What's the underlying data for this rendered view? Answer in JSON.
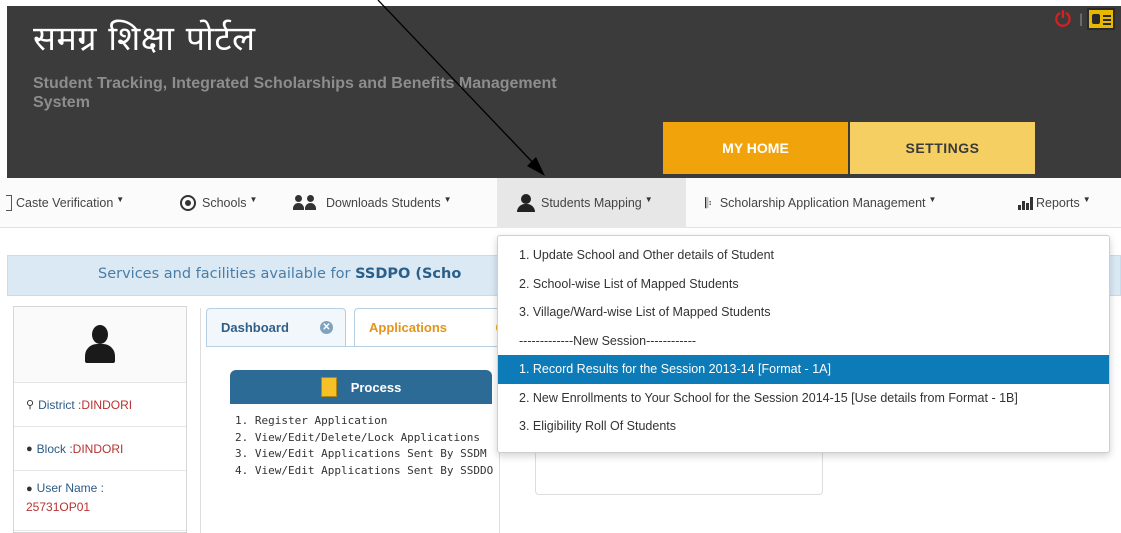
{
  "header": {
    "title": "समग्र शिक्षा पोर्टल",
    "subtitle": "Student Tracking, Integrated Scholarships and Benefits Management System",
    "tabs": [
      {
        "label": "MY HOME",
        "color": "#f0a30a"
      },
      {
        "label": "SETTINGS",
        "color": "#f6cf63"
      }
    ],
    "top_icons": [
      "power-icon",
      "id-card-icon"
    ],
    "top_separator": "|"
  },
  "menu": {
    "items": [
      {
        "label": "Caste Verification",
        "icon": "bracket-icon"
      },
      {
        "label": "Schools",
        "icon": "circle-icon"
      },
      {
        "label": "Downloads Students",
        "icon": "users-icon"
      },
      {
        "label": "Students Mapping",
        "icon": "user-icon",
        "active": true
      },
      {
        "label": "Scholarship Application Management",
        "icon": "paperclip-icon"
      },
      {
        "label": "Reports",
        "icon": "bar-chart-icon"
      }
    ],
    "caret": "▼"
  },
  "dropdown": {
    "items": [
      {
        "label": "1. Update School and Other details of Student"
      },
      {
        "label": "2. School-wise List of Mapped Students"
      },
      {
        "label": "3. Village/Ward-wise List of Mapped Students"
      },
      {
        "label": "-------------New Session------------"
      },
      {
        "label": "1. Record Results for the Session 2013-14 [Format - 1A]",
        "highlighted": true
      },
      {
        "label": "2. New Enrollments to Your School for the Session 2014-15 [Use details from Format - 1B]"
      },
      {
        "label": "3. Eligibility Roll Of Students"
      }
    ],
    "highlight_color": "#0c7bb8"
  },
  "services": {
    "prefix": "Services and facilities available for ",
    "entity": "SSDPO (Scho"
  },
  "profile": {
    "district_label": "District : ",
    "district_value": "DINDORI",
    "block_label": "Block : ",
    "block_value": "DINDORI",
    "username_label": "User Name :",
    "username_value": "25731OP01"
  },
  "tabs": {
    "dashboard": "Dashboard",
    "applications": "Applications",
    "close_glyph": "✕"
  },
  "process": {
    "title": "Process",
    "items": [
      "1. Register Application",
      "2. View/Edit/Delete/Lock Applications",
      "3. View/Edit Applications Sent By SSDM",
      "4. View/Edit Applications Sent By SSDDO"
    ]
  }
}
